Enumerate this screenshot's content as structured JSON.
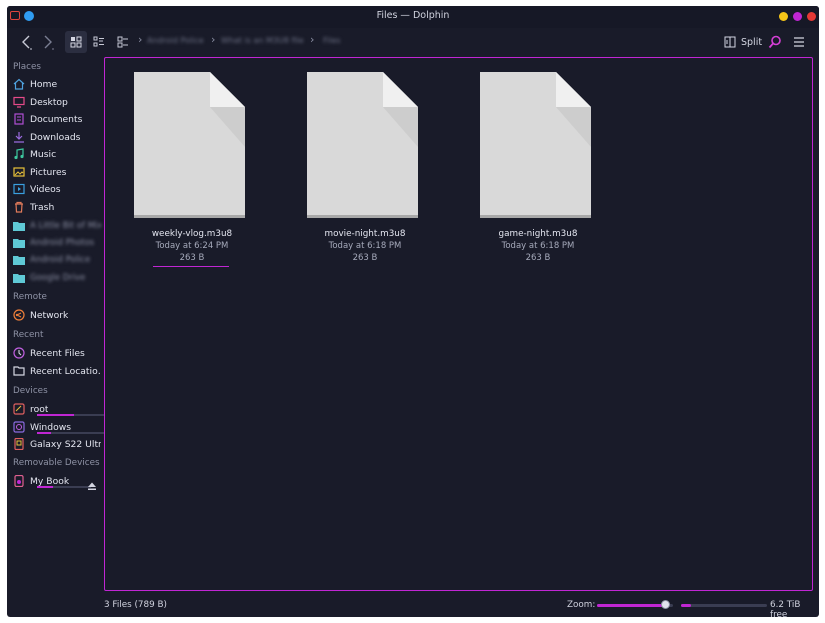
{
  "window": {
    "title": "Files — Dolphin"
  },
  "toolbar": {
    "back_icon": "chevron-left-icon",
    "forward_icon": "chevron-right-icon",
    "view_modes": [
      "icons-view-icon",
      "details-view-icon",
      "compact-view-icon"
    ],
    "breadcrumb": [
      "Android Police",
      "What is an M3U8 file",
      "Files"
    ],
    "split_label": "Split"
  },
  "sidebar": {
    "places_label": "Places",
    "places": [
      {
        "label": "Home",
        "icon": "home-icon"
      },
      {
        "label": "Desktop",
        "icon": "desktop-icon"
      },
      {
        "label": "Documents",
        "icon": "documents-icon"
      },
      {
        "label": "Downloads",
        "icon": "downloads-icon"
      },
      {
        "label": "Music",
        "icon": "music-icon"
      },
      {
        "label": "Pictures",
        "icon": "pictures-icon"
      },
      {
        "label": "Videos",
        "icon": "videos-icon"
      },
      {
        "label": "Trash",
        "icon": "trash-icon"
      }
    ],
    "folders": [
      "A Little Bit of Mix",
      "Android Photos",
      "Android Police",
      "Google Drive"
    ],
    "remote_label": "Remote",
    "remote": [
      {
        "label": "Network",
        "icon": "network-icon"
      }
    ],
    "recent_label": "Recent",
    "recent": [
      {
        "label": "Recent Files",
        "icon": "recent-files-icon"
      },
      {
        "label": "Recent Locatio…",
        "icon": "recent-locations-icon"
      }
    ],
    "devices_label": "Devices",
    "devices": [
      {
        "label": "root",
        "icon": "drive-icon",
        "usage": 0.55
      },
      {
        "label": "Windows",
        "icon": "windows-drive-icon",
        "usage": 0.2
      },
      {
        "label": "Galaxy S22 Ultra",
        "icon": "phone-icon"
      }
    ],
    "removable_label": "Removable Devices",
    "removable": [
      {
        "label": "My Book",
        "icon": "external-drive-icon",
        "usage": 0.3
      }
    ]
  },
  "files": [
    {
      "name": "weekly-vlog.m3u8",
      "date": "Today at 6:24 PM",
      "size": "263 B"
    },
    {
      "name": "movie-night.m3u8",
      "date": "Today at 6:18 PM",
      "size": "263 B"
    },
    {
      "name": "game-night.m3u8",
      "date": "Today at 6:18 PM",
      "size": "263 B"
    }
  ],
  "status": {
    "summary": "3 Files (789 B)",
    "zoom_label": "Zoom:",
    "zoom_level": 0.9,
    "space_used": 0.12,
    "free_label": "6.2 TiB free"
  },
  "colors": {
    "accent": "#c026d3",
    "background": "#191b29"
  }
}
